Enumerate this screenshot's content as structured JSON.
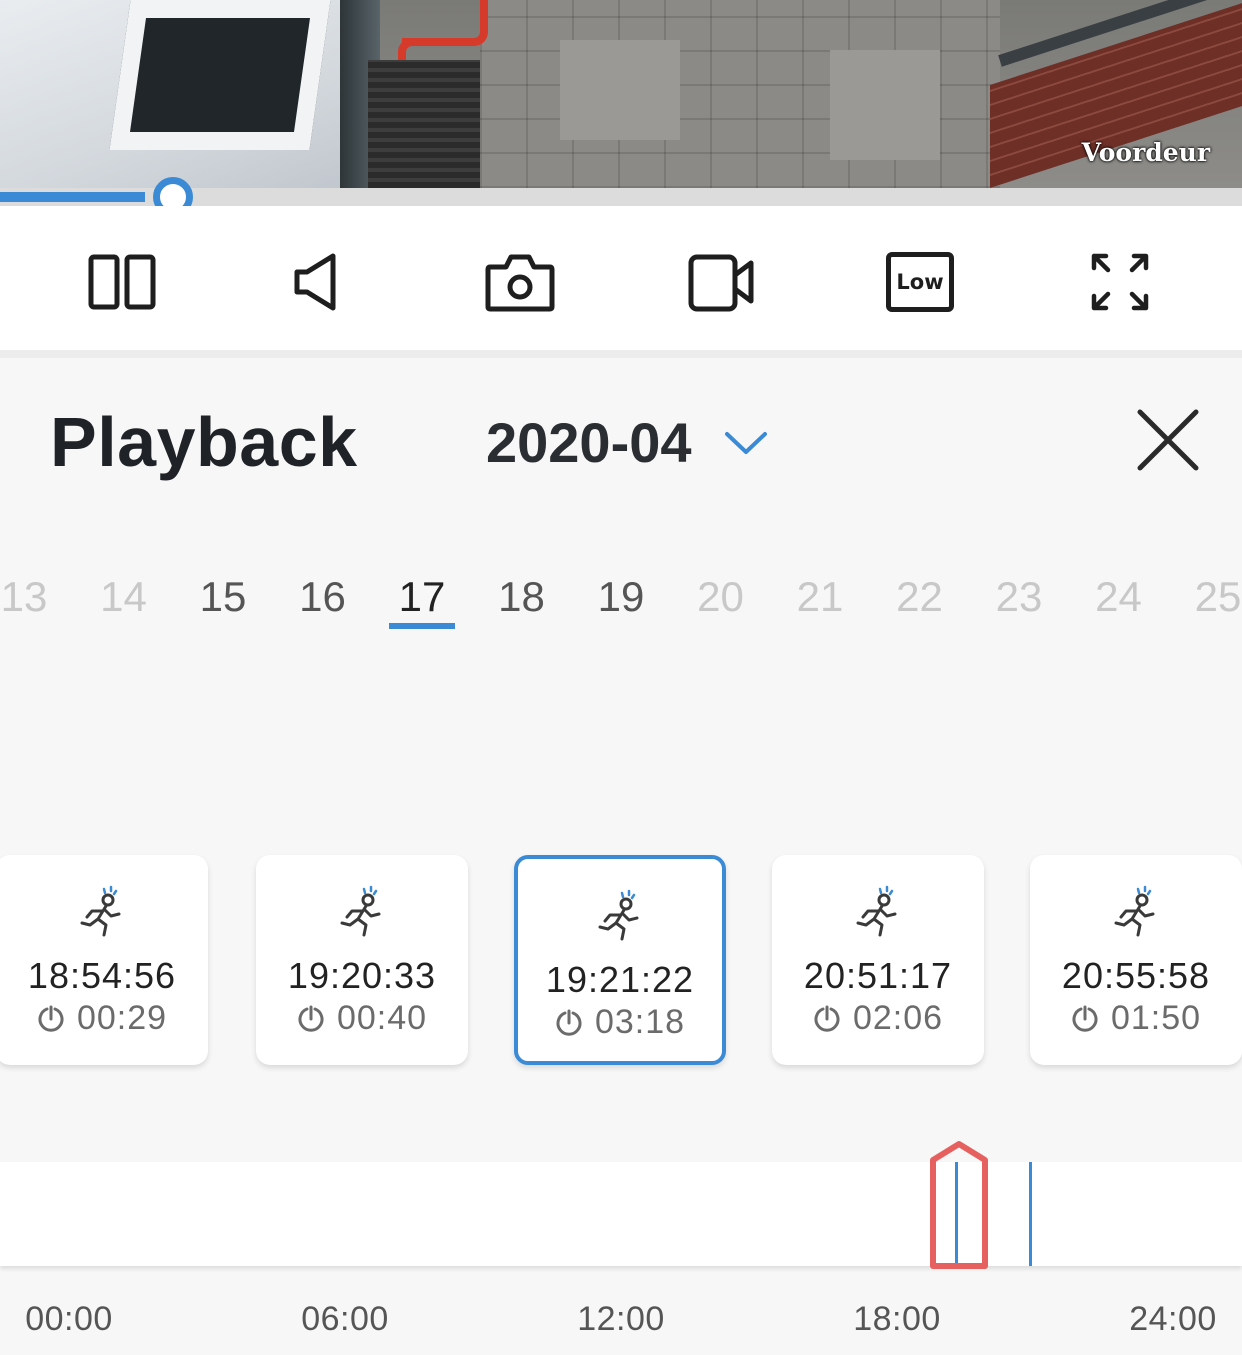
{
  "feed": {
    "camera_label": "Voordeur"
  },
  "player": {
    "progress": 0.117
  },
  "controls": {
    "items": [
      {
        "name": "split-view-button",
        "icon": "split-view-icon"
      },
      {
        "name": "mute-button",
        "icon": "speaker-icon"
      },
      {
        "name": "snapshot-button",
        "icon": "camera-icon"
      },
      {
        "name": "record-button",
        "icon": "video-camera-icon"
      },
      {
        "name": "quality-button",
        "icon": "quality-badge-icon",
        "label": "Low"
      },
      {
        "name": "fullscreen-button",
        "icon": "expand-icon"
      }
    ]
  },
  "playback": {
    "title": "Playback",
    "month": "2020-04"
  },
  "dates": {
    "days": [
      "13",
      "14",
      "15",
      "16",
      "17",
      "18",
      "19",
      "20",
      "21",
      "22",
      "23",
      "24",
      "25"
    ],
    "has_recordings": [
      false,
      false,
      true,
      true,
      true,
      true,
      true,
      false,
      false,
      false,
      false,
      false,
      false
    ],
    "selected": "17"
  },
  "events": [
    {
      "time": "18:54:56",
      "duration": "00:29",
      "type": "motion"
    },
    {
      "time": "19:20:33",
      "duration": "00:40",
      "type": "motion"
    },
    {
      "time": "19:21:22",
      "duration": "03:18",
      "type": "motion",
      "selected": true
    },
    {
      "time": "20:51:17",
      "duration": "02:06",
      "type": "motion"
    },
    {
      "time": "20:55:58",
      "duration": "01:50",
      "type": "motion"
    }
  ],
  "timeline": {
    "ticks": [
      "00:00",
      "06:00",
      "12:00",
      "18:00",
      "24:00"
    ],
    "marks_hours": [
      19.3,
      20.9
    ]
  },
  "colors": {
    "accent": "#3a8ad6",
    "annotation": "#e5605f",
    "background": "#f7f7f7"
  }
}
